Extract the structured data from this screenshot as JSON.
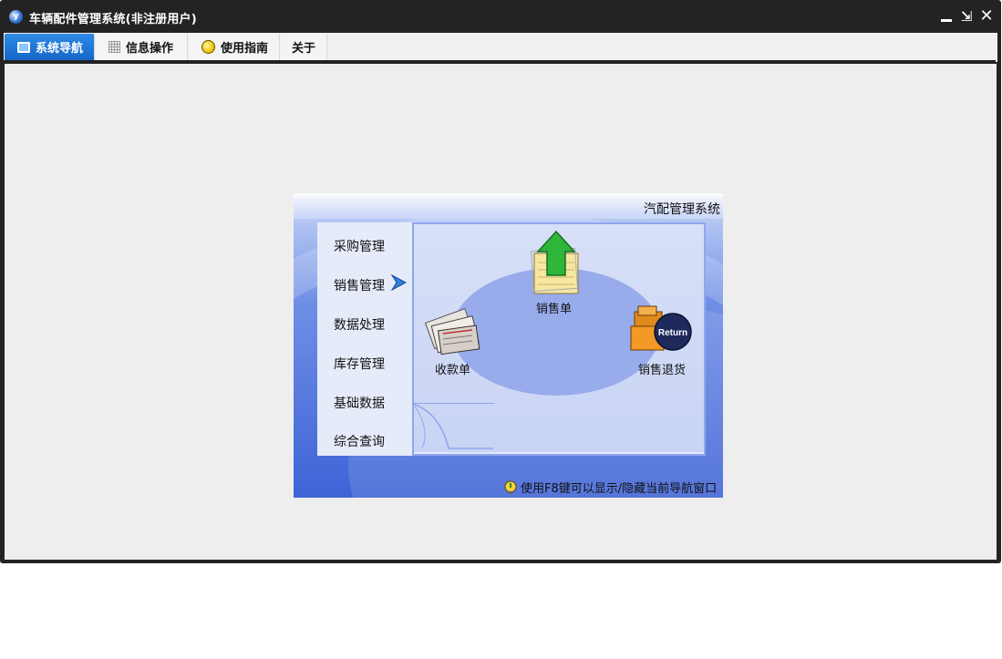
{
  "window": {
    "title": "车辆配件管理系统(非注册用户)",
    "app_icon": "y"
  },
  "tabs": [
    {
      "label": "系统导航",
      "icon": "monitor-icon",
      "active": true
    },
    {
      "label": "信息操作",
      "icon": "grid-icon",
      "active": false
    },
    {
      "label": "使用指南",
      "icon": "bulb-icon",
      "active": false
    },
    {
      "label": "关于",
      "icon": null,
      "active": false
    }
  ],
  "nav_panel": {
    "header_title": "汽配管理系统",
    "menu_items": [
      {
        "label": "采购管理"
      },
      {
        "label": "销售管理",
        "selected": true
      },
      {
        "label": "数据处理"
      },
      {
        "label": "库存管理"
      },
      {
        "label": "基础数据"
      },
      {
        "label": "综合查询"
      }
    ],
    "actions": [
      {
        "label": "销售单",
        "icon": "sales-order-icon"
      },
      {
        "label": "收款单",
        "icon": "receipt-icon"
      },
      {
        "label": "销售退货",
        "icon": "sales-return-icon",
        "badge": "Return"
      }
    ],
    "tip": "使用F8键可以显示/隐藏当前导航窗口"
  },
  "colors": {
    "titlebar": "#232323",
    "active_tab": "#1567c8",
    "panel_blue": "#3e63d6",
    "ellipse": "#98acec"
  }
}
